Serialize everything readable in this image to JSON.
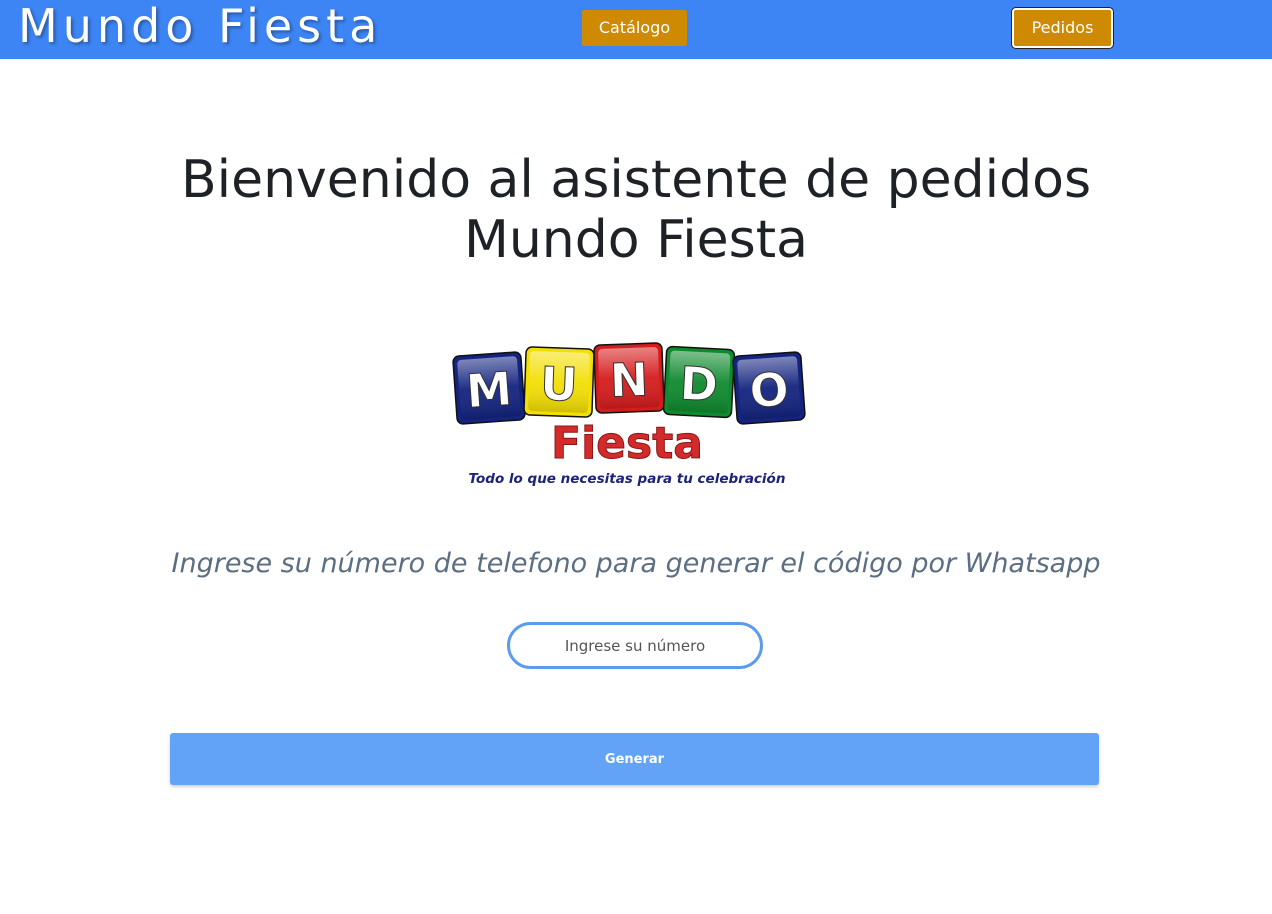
{
  "header": {
    "brand": "Mundo Fiesta",
    "nav": {
      "catalog_label": "Catálogo",
      "orders_label": "Pedidos"
    }
  },
  "main": {
    "headline_line1": "Bienvenido al asistente de pedidos",
    "headline_line2": "Mundo Fiesta",
    "logo": {
      "letters": [
        "M",
        "U",
        "N",
        "D",
        "O"
      ],
      "word": "Fiesta",
      "tagline": "Todo lo que necesitas para tu celebración"
    },
    "prompt": "Ingrese su número de telefono para generar el código por Whatsapp",
    "phone_input": {
      "placeholder": "Ingrese su número",
      "value": ""
    },
    "generate_label": "Generar"
  },
  "colors": {
    "header_bg": "#3d85f5",
    "nav_button_bg": "#cf8a03",
    "generate_bg": "#62a3f7",
    "input_border": "#5b9bee",
    "logo_blocks": [
      "#13237f",
      "#f3df05",
      "#d51c1d",
      "#0f8a2e",
      "#13237f"
    ],
    "logo_word": "#d32b2b",
    "logo_tagline": "#1b237a"
  }
}
